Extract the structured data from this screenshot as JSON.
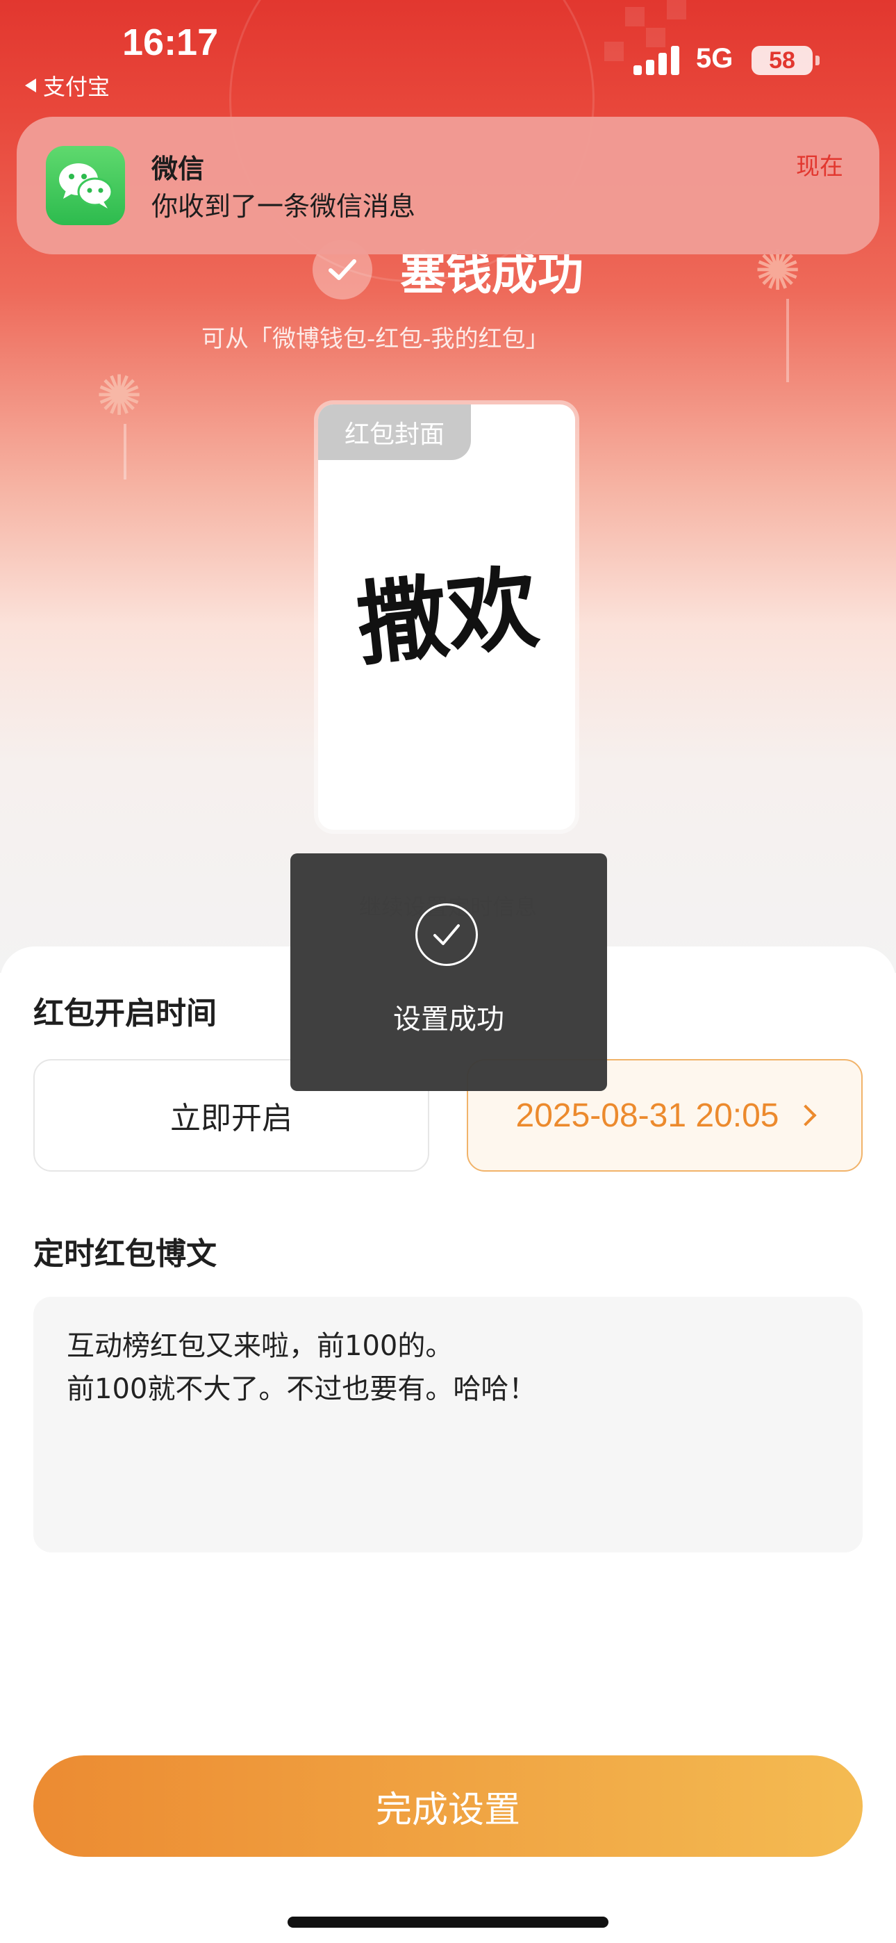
{
  "status_bar": {
    "time": "16:17",
    "back_app": "支付宝",
    "network": "5G",
    "battery": "58"
  },
  "notification": {
    "app_name": "微信",
    "message": "你收到了一条微信消息",
    "time": "现在",
    "icon": "wechat-icon"
  },
  "success": {
    "title": "塞钱成功",
    "hint": "可从「微博钱包-红包-我的红包」"
  },
  "cover": {
    "tag": "红包封面",
    "art_text": "撒欢"
  },
  "below_cover_text": "继续设置定时信息",
  "toast": {
    "text": "设置成功"
  },
  "open_time": {
    "title": "红包开启时间",
    "immediate_label": "立即开启",
    "scheduled_value": "2025-08-31 20:05"
  },
  "post": {
    "title": "定时红包博文",
    "lines": [
      "互动榜红包又来啦，前100的。",
      "前100就不大了。不过也要有。哈哈！"
    ]
  },
  "primary_button": {
    "label": "完成设置"
  },
  "colors": {
    "brand_red": "#e2372f",
    "accent_orange": "#ec8a2d",
    "button_gradient_start": "#ec8b32",
    "button_gradient_end": "#f4bb52"
  }
}
